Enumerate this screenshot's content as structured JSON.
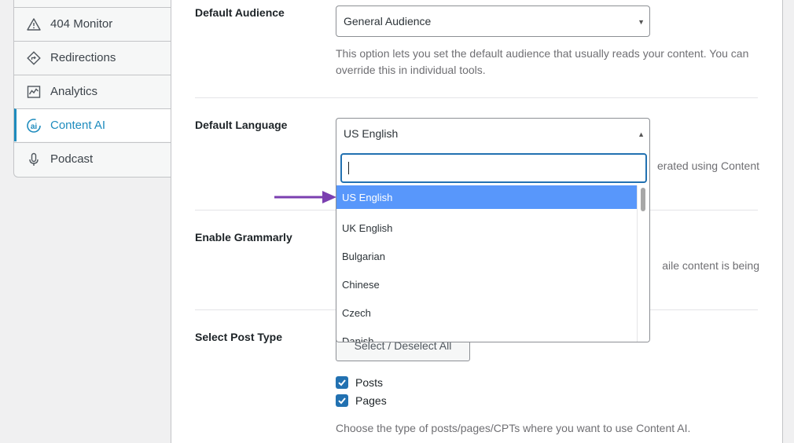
{
  "sidebar": {
    "items": [
      {
        "label": "404 Monitor",
        "icon": "warning-triangle-icon"
      },
      {
        "label": "Redirections",
        "icon": "redirect-diamond-icon"
      },
      {
        "label": "Analytics",
        "icon": "chart-line-icon"
      },
      {
        "label": "Content AI",
        "icon": "content-ai-icon",
        "active": true
      },
      {
        "label": "Podcast",
        "icon": "microphone-icon"
      }
    ]
  },
  "settings": {
    "audience": {
      "label": "Default Audience",
      "value": "General Audience",
      "description": "This option lets you set the default audience that usually reads your content. You can override this in individual tools."
    },
    "language": {
      "label": "Default Language",
      "value": "US English",
      "description_partial": "erated using Content",
      "search_value": "",
      "options": [
        "US English",
        "UK English",
        "Bulgarian",
        "Chinese",
        "Czech",
        "Danish"
      ],
      "highlighted": "US English"
    },
    "grammarly": {
      "label": "Enable Grammarly",
      "description_partial": "aile content is being"
    },
    "post_type": {
      "label": "Select Post Type",
      "toggle_button": "Select / Deselect All",
      "options": [
        {
          "label": "Posts",
          "checked": true
        },
        {
          "label": "Pages",
          "checked": true
        }
      ],
      "description": "Choose the type of posts/pages/CPTs where you want to use Content AI."
    }
  },
  "colors": {
    "accent": "#1e8cbe",
    "highlight": "#5897fb",
    "checkbox": "#2271b1",
    "annotation_arrow": "#7b3fb0"
  }
}
